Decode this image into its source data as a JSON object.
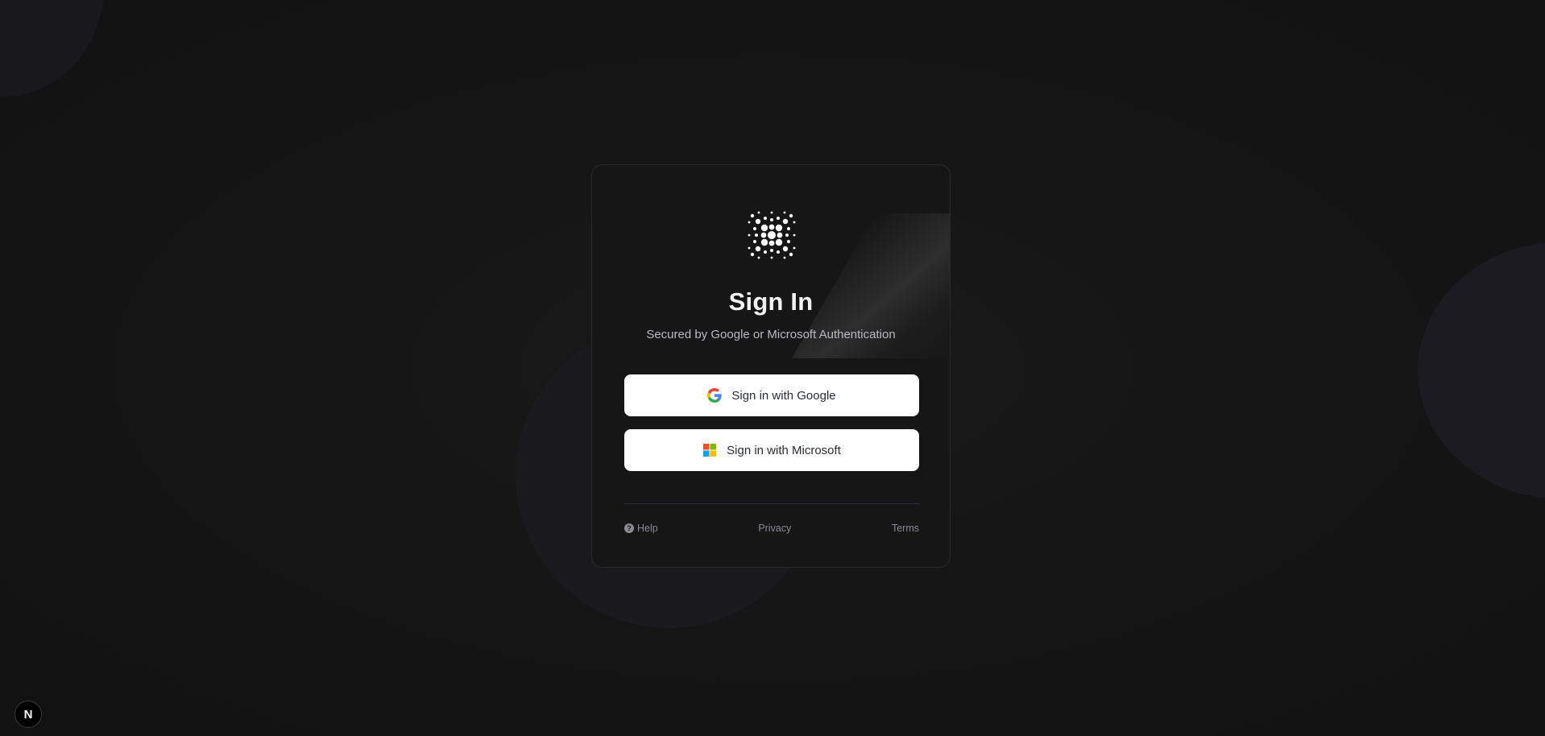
{
  "signin": {
    "title": "Sign In",
    "subtitle": "Secured by Google or Microsoft Authentication",
    "google_button": "Sign in with Google",
    "microsoft_button": "Sign in with Microsoft"
  },
  "footer": {
    "help": "Help",
    "privacy": "Privacy",
    "terms": "Terms"
  },
  "badge": {
    "letter": "N"
  },
  "icons": {
    "logo": "dotted-x-logo",
    "google": "google-icon",
    "microsoft": "microsoft-icon",
    "help": "help-icon"
  },
  "colors": {
    "background": "#151515",
    "card": "#161617",
    "button": "#ffffff",
    "google_blue": "#4285F4",
    "google_red": "#EA4335",
    "google_yellow": "#FBBC05",
    "google_green": "#34A853",
    "ms_red": "#F25022",
    "ms_green": "#7FBA00",
    "ms_blue": "#00A4EF",
    "ms_yellow": "#FFB900"
  }
}
